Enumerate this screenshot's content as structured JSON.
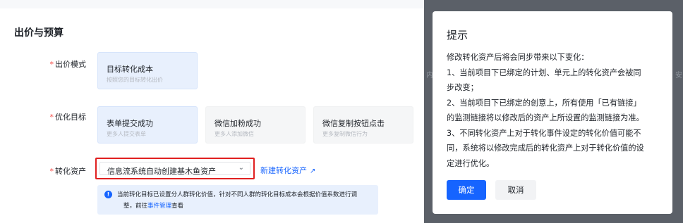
{
  "left": {
    "section_title": "出价与预算",
    "required_mark": "*",
    "bid_mode": {
      "label": "出价模式",
      "card": {
        "title": "目标转化成本",
        "subtitle": "按照您的目标转化出价"
      }
    },
    "optimization_goal": {
      "label": "优化目标",
      "cards": [
        {
          "title": "表单提交成功",
          "subtitle": "更多人提交表单"
        },
        {
          "title": "微信加粉成功",
          "subtitle": "更多人添加微信"
        },
        {
          "title": "微信复制按钮点击",
          "subtitle": "更多复制微信行为"
        }
      ]
    },
    "conversion_asset": {
      "label": "转化资产",
      "selected_value": "信息流系统自动创建基木鱼资产",
      "new_link": "新建转化资产",
      "external_icon": "external-link-icon"
    },
    "notice": {
      "icon": "info-icon",
      "line1": "当前转化目标已设置分人群转化价值，针对不同人群的转化目标成本会根据价值系数进行调",
      "line2_prefix": "整，前往",
      "line2_link": "事件管理",
      "line2_suffix": "查看"
    }
  },
  "right": {
    "background_fragments": [
      "内",
      "安"
    ],
    "dialog": {
      "title": "提示",
      "lines": [
        "修改转化资产后将会同步带来以下变化：",
        "1、当前项目下已绑定的计划、单元上的转化资产会被同",
        "步改变；",
        "2、当前项目下已绑定的创意上，所有使用「已有链接」",
        "的监测链接将以修改后的资产上所设置的监测链接为准。",
        "3、不同转化资产上对于转化事件设定的转化价值可能不",
        "同，系统将以修改完成后的转化资产上对于转化价值的设",
        "定进行优化。"
      ],
      "confirm_label": "确定",
      "cancel_label": "取消"
    }
  },
  "colors": {
    "primary": "#1664ff",
    "danger_outline": "#e02020",
    "selected_card": "#e8f0fd"
  }
}
